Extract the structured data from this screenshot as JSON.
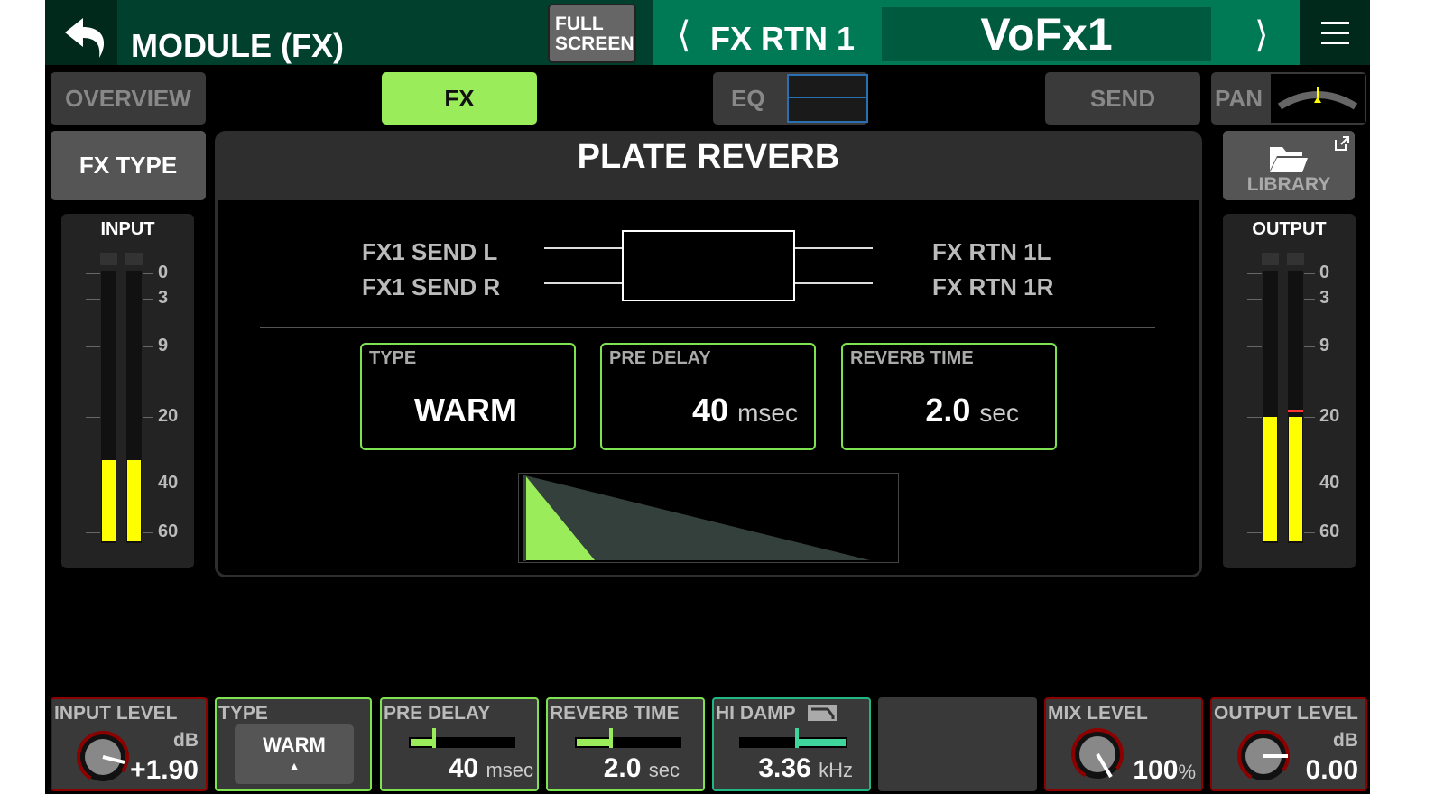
{
  "header": {
    "title": "MODULE (FX)",
    "fullscreen_label": [
      "FULL",
      "SCREEN"
    ],
    "channel": "FX RTN 1",
    "channel_name": "VoFx1",
    "back_icon": "undo-arrow-icon",
    "menu_icon": "hamburger-icon"
  },
  "tabs": {
    "overview": "OVERVIEW",
    "fx": "FX",
    "eq": "EQ",
    "send": "SEND",
    "pan": "PAN"
  },
  "fx_type_button": "FX TYPE",
  "library_button": "LIBRARY",
  "effect": {
    "name": "PLATE REVERB",
    "inputs": [
      "FX1 SEND L",
      "FX1 SEND R"
    ],
    "outputs": [
      "FX RTN 1L",
      "FX RTN 1R"
    ],
    "params": [
      {
        "label": "TYPE",
        "value": "WARM",
        "unit": ""
      },
      {
        "label": "PRE DELAY",
        "value": "40",
        "unit": "msec"
      },
      {
        "label": "REVERB TIME",
        "value": "2.0",
        "unit": "sec"
      }
    ]
  },
  "meters": {
    "input_label": "INPUT",
    "output_label": "OUTPUT",
    "scale": [
      "0",
      "3",
      "9",
      "20",
      "40",
      "60"
    ],
    "input_level_db": -33,
    "output_level_db": -20
  },
  "bottom": {
    "input_level": {
      "label": "INPUT LEVEL",
      "unit": "dB",
      "value": "+1.90"
    },
    "type": {
      "label": "TYPE",
      "value": "WARM"
    },
    "pre_delay": {
      "label": "PRE DELAY",
      "value": "40",
      "unit": "msec"
    },
    "reverb_time": {
      "label": "REVERB TIME",
      "value": "2.0",
      "unit": "sec"
    },
    "hi_damp": {
      "label": "HI DAMP",
      "value": "3.36",
      "unit": "kHz"
    },
    "mix_level": {
      "label": "MIX LEVEL",
      "value": "100",
      "unit": "%"
    },
    "output_level": {
      "label": "OUTPUT LEVEL",
      "unit": "dB",
      "value": "0.00"
    }
  },
  "colors": {
    "accent": "#9bec5b",
    "header_green": "#007a55",
    "meter": "#ffff00",
    "knob_ring": "#8c0000"
  }
}
